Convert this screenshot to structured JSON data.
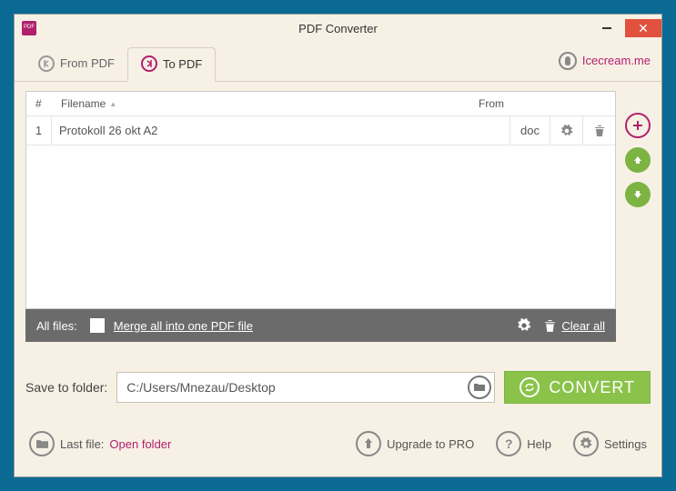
{
  "window": {
    "title": "PDF Converter"
  },
  "tabs": {
    "from": "From PDF",
    "to": "To PDF"
  },
  "brand": "Icecream.me",
  "thead": {
    "num": "#",
    "filename": "Filename",
    "from": "From"
  },
  "rows": [
    {
      "num": "1",
      "name": "Protokoll 26 okt A2",
      "from": "doc"
    }
  ],
  "actionbar": {
    "all": "All files:",
    "merge": "Merge all into one PDF file",
    "clear": "Clear all"
  },
  "save": {
    "label": "Save to folder:",
    "path": "C:/Users/Mnezau/Desktop"
  },
  "convert": "CONVERT",
  "footer": {
    "last": "Last file:",
    "open": "Open folder",
    "upgrade": "Upgrade to PRO",
    "help": "Help",
    "settings": "Settings"
  }
}
